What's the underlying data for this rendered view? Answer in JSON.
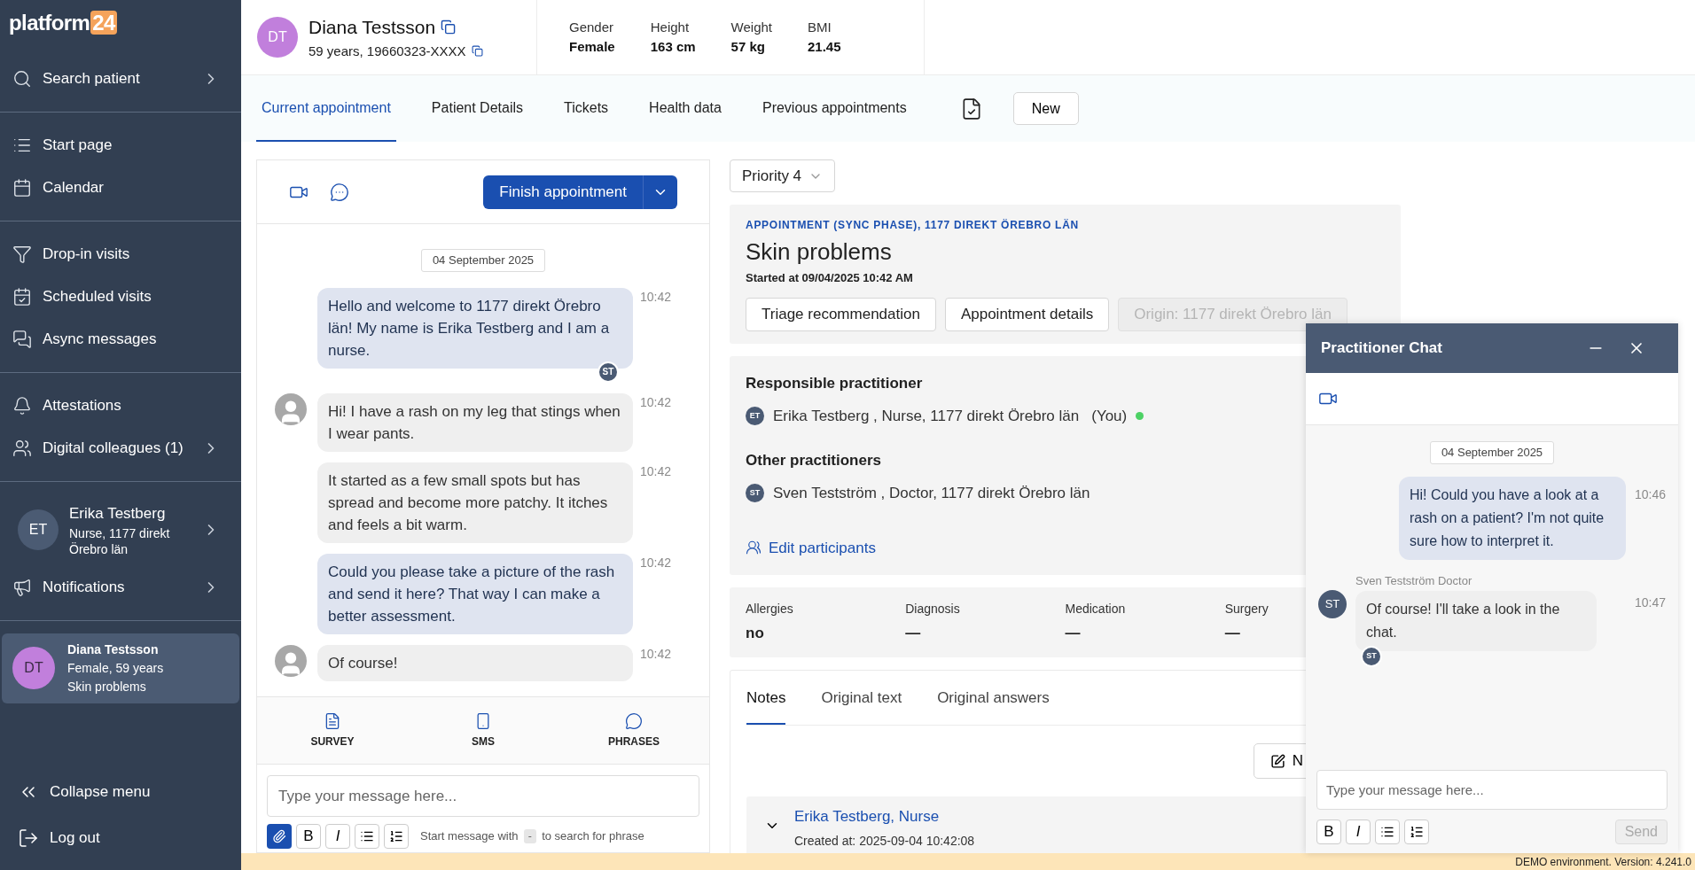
{
  "sidebar": {
    "logo": {
      "text": "platform",
      "badge": "24"
    },
    "nav_sections": [
      [
        {
          "kind": "link",
          "label": "Search patient",
          "submenu": true
        }
      ],
      [
        {
          "kind": "link",
          "label": "Start page",
          "submenu": false
        },
        {
          "kind": "link",
          "label": "Calendar",
          "submenu": false
        }
      ],
      [
        {
          "kind": "link",
          "label": "Drop-in visits",
          "submenu": false
        },
        {
          "kind": "link",
          "label": "Scheduled visits",
          "submenu": false
        },
        {
          "kind": "link",
          "label": "Async messages",
          "submenu": false
        }
      ],
      [
        {
          "kind": "link",
          "label": "Attestations",
          "submenu": false
        },
        {
          "kind": "link",
          "label": "Digital colleagues (1)",
          "submenu": true
        }
      ],
      [
        {
          "kind": "profile",
          "initials": "ET",
          "name": "Erika Testberg",
          "role": "Nurse, 1177 direkt Örebro län",
          "submenu": true
        },
        {
          "kind": "link",
          "label": "Notifications",
          "submenu": true
        }
      ]
    ],
    "current_patient": {
      "initials": "DT",
      "name": "Diana Testsson",
      "details": "Female, 59 years",
      "reason": "Skin problems",
      "selected": true
    },
    "footer": [
      {
        "label": "Collapse menu"
      },
      {
        "label": "Log out"
      }
    ]
  },
  "patient": {
    "initials": "DT",
    "name": "Diana Testsson",
    "details": "59 years, 19660323-XXXX",
    "stats": [
      {
        "label": "Gender",
        "value": "Female"
      },
      {
        "label": "Height",
        "value": "163 cm"
      },
      {
        "label": "Weight",
        "value": "57 kg"
      },
      {
        "label": "BMI",
        "value": "21.45"
      }
    ]
  },
  "tabs": [
    {
      "label": "Current appointment",
      "selected": true
    },
    {
      "label": "Patient Details",
      "selected": false
    },
    {
      "label": "Tickets",
      "selected": false
    },
    {
      "label": "Health data",
      "selected": false
    },
    {
      "label": "Previous appointments",
      "selected": false
    }
  ],
  "new_button": "New",
  "chat": {
    "finish_button": "Finish appointment",
    "date": "04 September 2025",
    "messages": [
      {
        "kind": "outgoing",
        "text": "Hello and welcome to 1177 direkt Örebro län! My name is Erika Testberg and I am a nurse.",
        "time": "10:42",
        "read_by": "ST"
      },
      {
        "kind": "incoming",
        "text": "Hi! I have a rash on my leg that stings when I wear pants.",
        "time": "10:42",
        "avatar": true
      },
      {
        "kind": "incoming",
        "text": "It started as a few small spots but has spread and become more patchy. It itches and feels a bit warm.",
        "time": "10:42",
        "avatar": false
      },
      {
        "kind": "outgoing",
        "text": "Could you please take a picture of the rash and send it here? That way I can make a better assessment.",
        "time": "10:42"
      },
      {
        "kind": "incoming",
        "text": "Of course!",
        "time": "10:42",
        "avatar": true
      }
    ],
    "actions": [
      {
        "label": "SURVEY"
      },
      {
        "label": "SMS"
      },
      {
        "label": "PHRASES"
      }
    ],
    "placeholder": "Type your message here...",
    "format_buttons": [
      "B",
      "I"
    ],
    "hint": {
      "before": "Start message with",
      "key": "-",
      "after": "to search for phrase"
    }
  },
  "appointment": {
    "priority": "Priority 4",
    "kicker": "APPOINTMENT (SYNC PHASE), 1177 DIREKT ÖREBRO LÄN",
    "title": "Skin problems",
    "started": "Started at 09/04/2025 10:42 AM",
    "buttons": [
      {
        "label": "Triage recommendation",
        "disabled": false
      },
      {
        "label": "Appointment details",
        "disabled": false
      },
      {
        "label": "Origin: 1177 direkt Örebro län",
        "disabled": true
      }
    ]
  },
  "participants": {
    "responsible_heading": "Responsible practitioner",
    "responsible": {
      "initials": "ET",
      "text": "Erika Testberg , Nurse, 1177 direkt Örebro län",
      "you": "(You)",
      "online": true
    },
    "other_heading": "Other practitioners",
    "others": [
      {
        "initials": "ST",
        "text": "Sven Testström , Doctor, 1177 direkt Örebro län"
      }
    ],
    "edit_link": "Edit participants"
  },
  "summary": [
    {
      "label": "Allergies",
      "value": "no"
    },
    {
      "label": "Diagnosis",
      "value": "—"
    },
    {
      "label": "Medication",
      "value": "—"
    },
    {
      "label": "Surgery",
      "value": "—"
    }
  ],
  "notes": {
    "tabs": [
      {
        "label": "Notes",
        "selected": true
      },
      {
        "label": "Original text",
        "selected": false
      },
      {
        "label": "Original answers",
        "selected": false
      }
    ],
    "new_button": "N",
    "entries": [
      {
        "author": "Erika Testberg, Nurse",
        "created": "Created at: 2025-09-04 10:42:08",
        "expanded": true
      }
    ]
  },
  "practitioner_chat": {
    "title": "Practitioner Chat",
    "date": "04 September 2025",
    "messages": [
      {
        "kind": "outgoing",
        "text": "Hi! Could you have a look at a rash on a patient? I'm not quite sure how to interpret it.",
        "time": "10:46"
      },
      {
        "kind": "incoming",
        "sender": "Sven Testström Doctor",
        "initials": "ST",
        "text": "Of course! I'll take a look in the chat.",
        "time": "10:47",
        "read_by": "ST"
      }
    ],
    "placeholder": "Type your message here...",
    "format_buttons": [
      "B",
      "I"
    ],
    "send": {
      "label": "Send",
      "disabled": true
    }
  },
  "banner": "DEMO environment. Version: 4.241.0"
}
